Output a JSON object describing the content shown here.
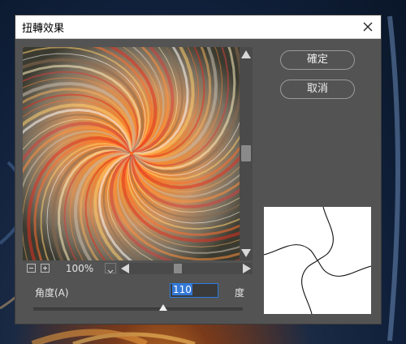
{
  "dialog": {
    "title": "扭轉效果",
    "ok_label": "確定",
    "cancel_label": "取消"
  },
  "preview": {
    "zoom": "100%"
  },
  "angle": {
    "label": "角度(A)",
    "value": "110",
    "unit": "度",
    "slider_fraction": 0.62
  },
  "colors": {
    "dialog_bg": "#535353",
    "focus_border": "#2b7de0",
    "selection": "#3478d6"
  }
}
